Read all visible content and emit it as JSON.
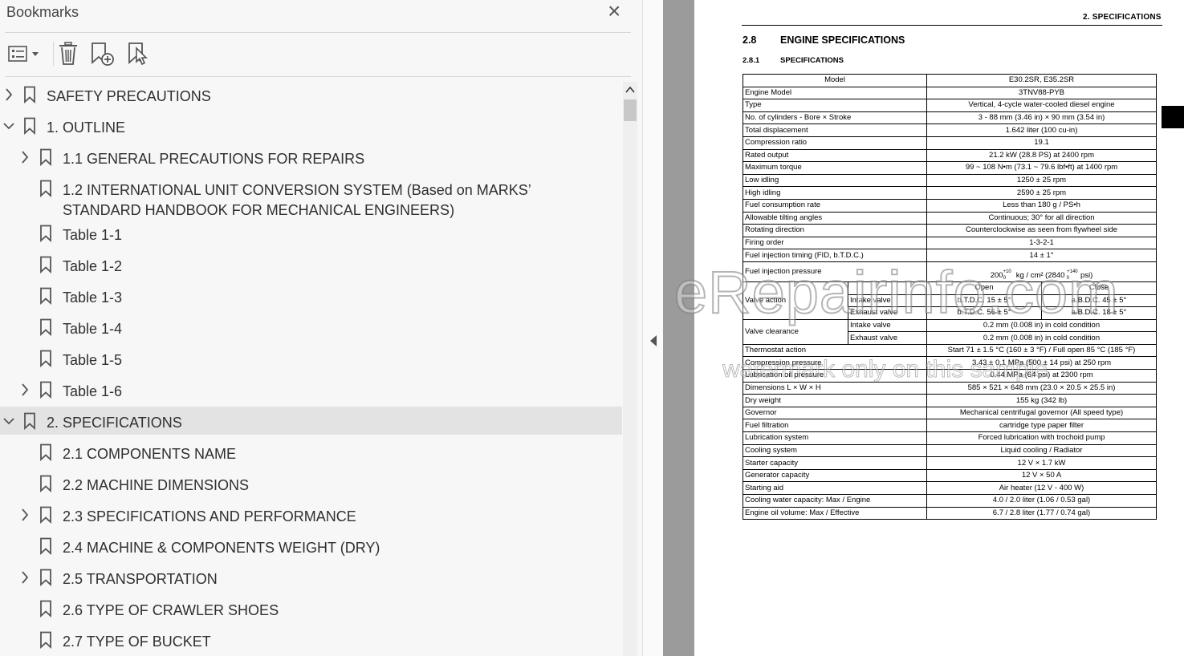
{
  "panel": {
    "title": "Bookmarks",
    "close_icon": "×",
    "toolbar": {
      "options_icon": "list-options-icon",
      "delete_icon": "trash-icon",
      "new_icon": "bookmark-add-icon",
      "find_icon": "bookmark-find-icon"
    }
  },
  "bookmarks": [
    {
      "label": "SAFETY PRECAUTIONS",
      "level": 0,
      "expander": "collapsed"
    },
    {
      "label": "1. OUTLINE",
      "level": 0,
      "expander": "expanded"
    },
    {
      "label": "1.1 GENERAL PRECAUTIONS FOR REPAIRS",
      "level": 1,
      "expander": "collapsed"
    },
    {
      "label": "1.2 INTERNATIONAL UNIT CONVERSION SYSTEM (Based on MARKS’ STANDARD HANDBOOK FOR MECHANICAL ENGINEERS)",
      "level": 1,
      "expander": "none"
    },
    {
      "label": "Table 1-1",
      "level": 1,
      "expander": "none"
    },
    {
      "label": "Table 1-2",
      "level": 1,
      "expander": "none"
    },
    {
      "label": "Table 1-3",
      "level": 1,
      "expander": "none"
    },
    {
      "label": "Table 1-4",
      "level": 1,
      "expander": "none"
    },
    {
      "label": "Table 1-5",
      "level": 1,
      "expander": "none"
    },
    {
      "label": "Table 1-6",
      "level": 1,
      "expander": "collapsed"
    },
    {
      "label": "2. SPECIFICATIONS",
      "level": 0,
      "expander": "expanded",
      "selected": true
    },
    {
      "label": "2.1 COMPONENTS NAME",
      "level": 1,
      "expander": "none"
    },
    {
      "label": "2.2 MACHINE DIMENSIONS",
      "level": 1,
      "expander": "none"
    },
    {
      "label": "2.3 SPECIFICATIONS AND PERFORMANCE",
      "level": 1,
      "expander": "collapsed"
    },
    {
      "label": "2.4 MACHINE & COMPONENTS WEIGHT (DRY)",
      "level": 1,
      "expander": "none"
    },
    {
      "label": "2.5 TRANSPORTATION",
      "level": 1,
      "expander": "collapsed"
    },
    {
      "label": "2.6 TYPE OF CRAWLER SHOES",
      "level": 1,
      "expander": "none"
    },
    {
      "label": "2.7 TYPE OF BUCKET",
      "level": 1,
      "expander": "none"
    }
  ],
  "document": {
    "running_header": "2. SPECIFICATIONS",
    "section_num": "2.8",
    "section_title": "ENGINE SPECIFICATIONS",
    "subsection_num": "2.8.1",
    "subsection_title": "SPECIFICATIONS",
    "table": {
      "model_label": "Model",
      "model_value": "E30.2SR, E35.2SR",
      "rows_a": [
        [
          "Engine Model",
          "3TNV88-PYB"
        ],
        [
          "Type",
          "Vertical, 4-cycle water-cooled diesel engine"
        ],
        [
          "No. of cylinders - Bore × Stroke",
          "3 - 88 mm (3.46 in) × 90 mm (3.54 in)"
        ],
        [
          "Total displacement",
          "1.642 liter (100 cu-in)"
        ],
        [
          "Compression ratio",
          "19.1"
        ],
        [
          "Rated output",
          "21.2 kW (28.8 PS) at 2400 rpm"
        ],
        [
          "Maximum torque",
          "99 ~ 108 N•m (73.1 ~ 79.6 lbf•ft) at 1400 rpm"
        ],
        [
          "Low idling",
          "1250 ± 25 rpm"
        ],
        [
          "High idling",
          "2590 ± 25 rpm"
        ],
        [
          "Fuel consumption rate",
          "Less than 180 g / PS•h"
        ],
        [
          "Allowable tilting angles",
          "Continuous; 30° for all direction"
        ],
        [
          "Rotating direction",
          "Counterclockwise as seen from flywheel side"
        ],
        [
          "Firing order",
          "1-3-2-1"
        ],
        [
          "Fuel injection timing (FID, b.T.D.C.)",
          "14 ± 1°"
        ]
      ],
      "fuel_pressure": {
        "label": "Fuel injection pressure",
        "value_a": "200",
        "sup_a": "+10",
        "sub_a": "0",
        "value_b": " kg / cm² (2840 ",
        "sup_b": "+140",
        "sub_b": "0",
        "value_c": "psi)"
      },
      "valve_action": {
        "label": "Valve action",
        "open_hdr": "Open",
        "close_hdr": "Close",
        "intake_label": "Intake valve",
        "intake_open": "b.T.D.C. 15 ± 5°",
        "intake_close": "a.B.D.C. 45 ± 5°",
        "exhaust_label": "Exhaust valve",
        "exhaust_open": "b.T.D.C. 56 ± 5°",
        "exhaust_close": "a.B.D.C. 18 ± 5°"
      },
      "valve_clearance": {
        "label": "Valve clearance",
        "intake_label": "Intake valve",
        "intake_value": "0.2 mm (0.008 in) in cold condition",
        "exhaust_label": "Exhaust valve",
        "exhaust_value": "0.2 mm (0.008 in) in cold condition"
      },
      "rows_b": [
        [
          "Thermostat action",
          "Start 71 ± 1.5 °C (160 ± 3 °F) / Full open 85 °C (185 °F)"
        ],
        [
          "Compression pressure",
          "3.43 ± 0.1 MPa (500 ± 14 psi) at 250 rpm"
        ],
        [
          "Lubrication oil pressure",
          "0.44 MPa (64 psi) at 2300 rpm"
        ],
        [
          "Dimensions L × W × H",
          "585 × 521 × 648 mm (23.0 × 20.5 × 25.5 in)"
        ],
        [
          "Dry weight",
          "155 kg (342 lb)"
        ],
        [
          "Governor",
          "Mechanical centrifugal governor (All speed type)"
        ],
        [
          "Fuel filtration",
          "cartridge type paper filter"
        ],
        [
          "Lubrication system",
          "Forced lubrication with trochoid pump"
        ],
        [
          "Cooling system",
          "Liquid cooling / Radiator"
        ],
        [
          "Starter capacity",
          "12 V × 1.7 kW"
        ],
        [
          "Generator capacity",
          "12 V × 50 A"
        ],
        [
          "Starting aid",
          "Air heater (12 V - 400 W)"
        ],
        [
          "Cooling water capacity: Max / Engine",
          "4.0 / 2.0 liter (1.06 / 0.53 gal)"
        ],
        [
          "Engine oil volume: Max / Effective",
          "6.7 / 2.8 liter (1.77 / 0.74 gal)"
        ]
      ]
    }
  },
  "watermark": {
    "line1": "eRepairinfo.com",
    "line2": "watermark only on this sample"
  }
}
